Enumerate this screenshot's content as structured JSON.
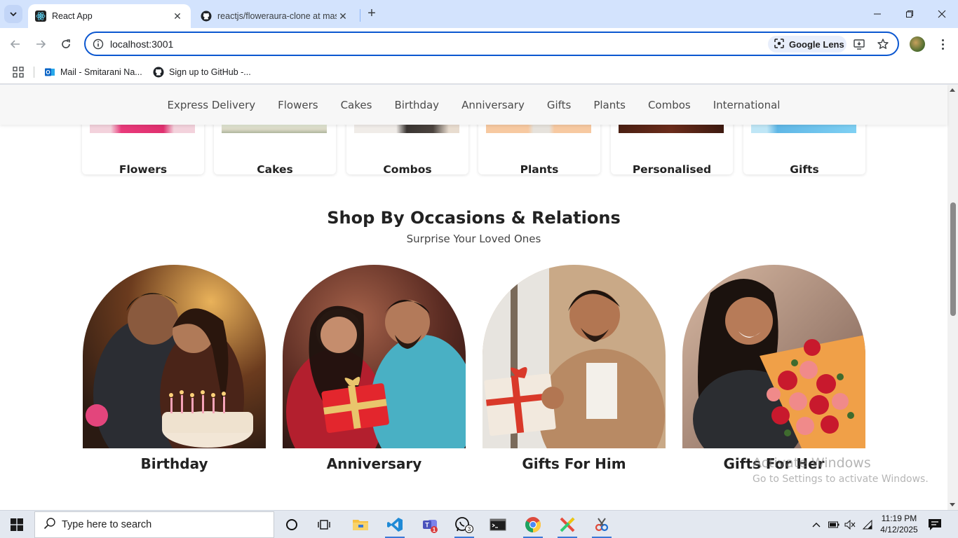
{
  "browser": {
    "tabs": [
      {
        "title": "React App",
        "active": true
      },
      {
        "title": "reactjs/floweraura-clone at mas",
        "active": false
      }
    ],
    "url": "localhost:3001",
    "lens_label": "Google Lens",
    "bookmarks": [
      {
        "label": "Mail - Smitarani Na..."
      },
      {
        "label": "Sign up to GitHub -..."
      }
    ]
  },
  "site": {
    "nav": [
      "Express Delivery",
      "Flowers",
      "Cakes",
      "Birthday",
      "Anniversary",
      "Gifts",
      "Plants",
      "Combos",
      "International"
    ],
    "categories": [
      "Flowers",
      "Cakes",
      "Combos",
      "Plants",
      "Personalised",
      "Gifts"
    ],
    "occasions_title": "Shop By Occasions & Relations",
    "occasions_subtitle": "Surprise Your Loved Ones",
    "occasions": [
      "Birthday",
      "Anniversary",
      "Gifts For Him",
      "Gifts For Her"
    ]
  },
  "watermark": {
    "line1": "Activate Windows",
    "line2": "Go to Settings to activate Windows."
  },
  "taskbar": {
    "search_placeholder": "Type here to search",
    "time": "11:19 PM",
    "date": "4/12/2025",
    "teams_badge": "1",
    "whatsapp_badge": "3"
  },
  "colors": {
    "tabstrip": "#d3e3fd",
    "omnibox_border": "#0b57d0",
    "nav_bg": "#f7f7f7"
  }
}
